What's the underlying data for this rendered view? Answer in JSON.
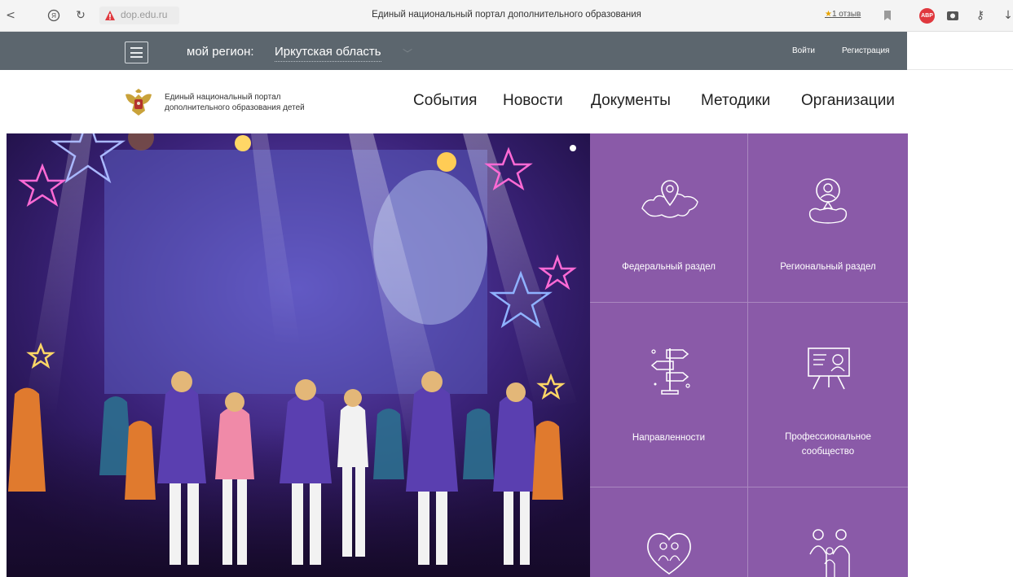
{
  "browser": {
    "url": "dop.edu.ru",
    "title": "Единый национальный портал дополнительного образования",
    "reviews": "1 отзыв",
    "adblock": "ABP"
  },
  "header": {
    "region_label": "мой регион:",
    "region_value": "Иркутская область",
    "login": "Войти",
    "register": "Регистрация"
  },
  "site": {
    "logo_line1": "Единый национальный портал",
    "logo_line2": "дополнительного образования детей"
  },
  "nav": {
    "items": [
      "События",
      "Новости",
      "Документы",
      "Методики",
      "Организации"
    ]
  },
  "tiles": [
    {
      "label": "Федеральный раздел",
      "icon": "russia-map-pin-icon"
    },
    {
      "label": "Региональный раздел",
      "icon": "region-person-pin-icon"
    },
    {
      "label": "Направленности",
      "icon": "signpost-icon"
    },
    {
      "label_line1": "Профессиональное",
      "label_line2": "сообщество",
      "icon": "teacher-board-icon"
    },
    {
      "label": "",
      "icon": "family-heart-icon"
    },
    {
      "label": "",
      "icon": "family-icon"
    }
  ],
  "colors": {
    "header_dark": "#5c666e",
    "tiles_purple": "#8a5aa8",
    "hero_bg": "#2b1658"
  }
}
